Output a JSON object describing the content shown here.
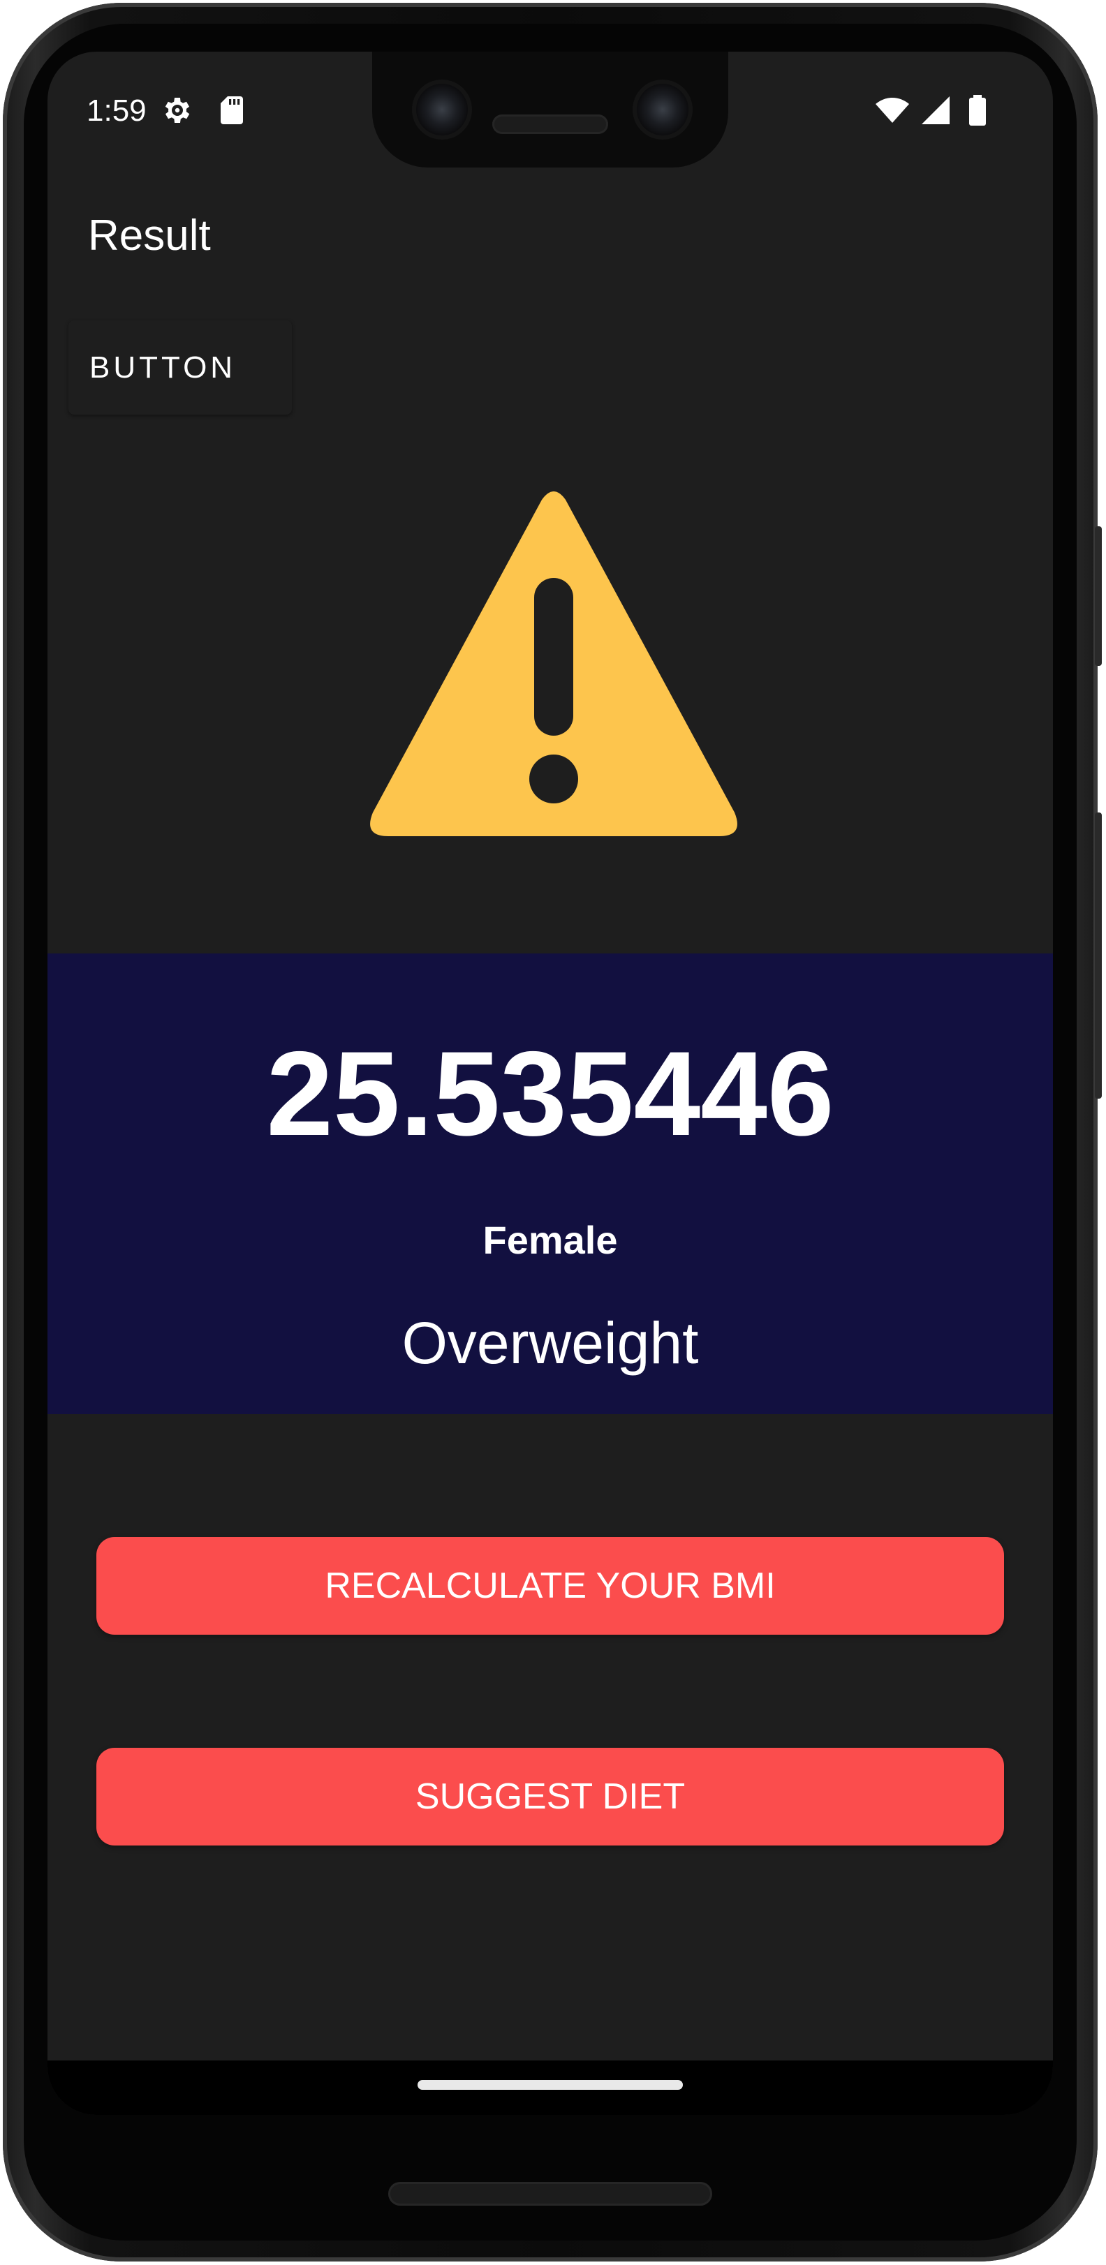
{
  "status_bar": {
    "time": "1:59",
    "left_icons": [
      "settings-gear-icon",
      "sd-card-icon"
    ],
    "right_icons": [
      "wifi-icon",
      "cellular-signal-icon",
      "battery-icon"
    ]
  },
  "app_bar": {
    "title": "Result"
  },
  "toolbar": {
    "button_label": "BUTTON"
  },
  "result": {
    "status_icon": "warning-icon",
    "bmi_value": "25.535446",
    "gender": "Female",
    "category": "Overweight"
  },
  "actions": {
    "recalculate_label": "RECALCULATE YOUR BMI",
    "suggest_diet_label": "SUGGEST DIET"
  },
  "colors": {
    "screen_background": "#1e1e1e",
    "result_panel": "#121040",
    "accent_button": "#fb4d4d",
    "warning": "#fdc54d"
  }
}
